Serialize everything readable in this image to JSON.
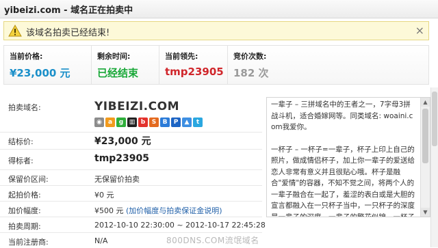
{
  "header": {
    "title": "yibeizi.com - 域名正在拍卖中"
  },
  "alert": {
    "message": "该域名拍卖已经结束!",
    "close": "×"
  },
  "stats": {
    "current_price": {
      "label": "当前价格:",
      "value": "¥23,000 元"
    },
    "time_left": {
      "label": "剩余时间:",
      "value": "已经结束"
    },
    "leader": {
      "label": "当前领先:",
      "value": "tmp23905"
    },
    "bid_count": {
      "label": "竞价次数:",
      "value": "182 次"
    }
  },
  "details": {
    "domain": {
      "label": "拍卖域名:",
      "value": "YIBEIZI.COM"
    },
    "final_price": {
      "label": "结标价:",
      "value": "¥23,000 元"
    },
    "winner": {
      "label": "得标者:",
      "value": "tmp23905"
    },
    "reserve": {
      "label": "保留价区间:",
      "value": "无保留价拍卖"
    },
    "start_price": {
      "label": "起拍价格:",
      "value": "¥0 元"
    },
    "increment": {
      "label": "加价幅度:",
      "value": "¥500 元",
      "link": "(加价幅度与拍卖保证金说明)"
    },
    "period": {
      "label": "拍卖周期:",
      "value": "2012-10-10 22:30:00 ~ 2012-10-17 22:45:28"
    },
    "registrar": {
      "label": "当前注册商:",
      "value": "N/A"
    }
  },
  "description": {
    "paragraph1": "一辈子 – 三拼域名中的王者之一，7字母3拼战斗机，适合婚嫁网等。同类域名: woaini.com我爱你。",
    "paragraph2": "一杯子 – 一杯子=一辈子，杯子上印上自己的照片，做成情侣杯子，加上你一辈子的爱送给恋人非常有意义并且很贴心哦。杯子是融合\"爱情\"的容器，不知不觉之间，将两个人的一辈子融合在一起了，羞涩的表白或是大胆的宣言都融入在一只杯子当中，一只杯子的深度是一辈子的深度。一辈子的繁花似锦，一杯子的淡泊透彻。"
  },
  "watermark": "800DNS.COM流氓域名",
  "colors": {
    "price": "#1a8fc9",
    "ended": "#19a838",
    "leader": "#d0262b",
    "count": "#9a9a9a",
    "alert_bg": "#fdf9d8"
  }
}
